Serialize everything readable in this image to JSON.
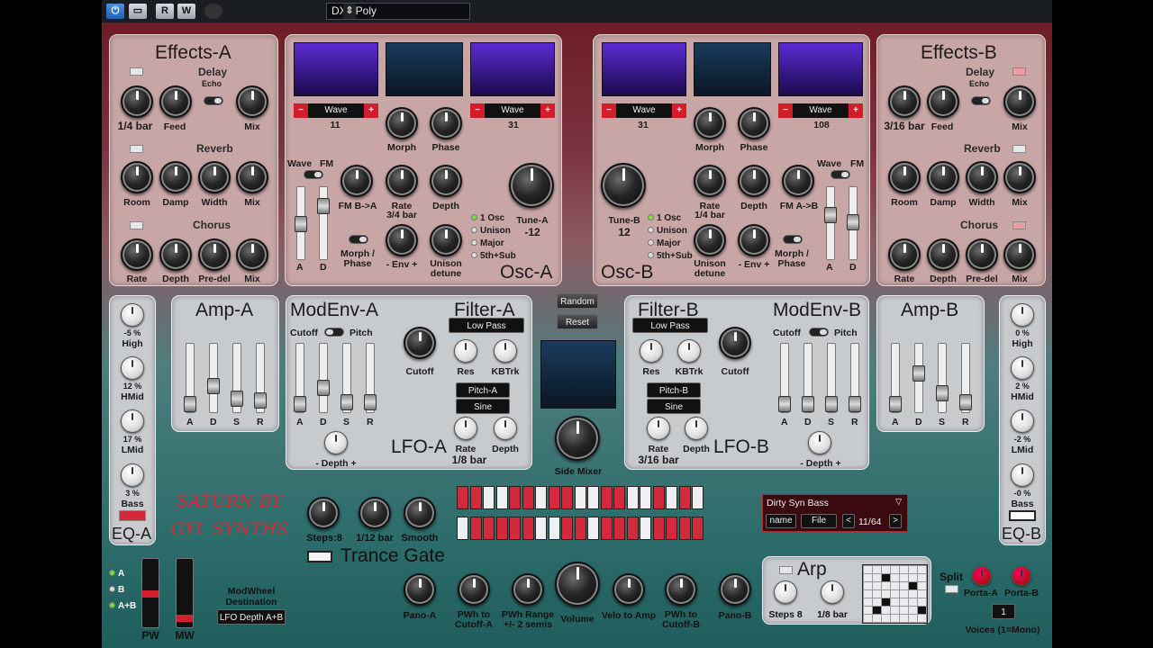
{
  "host": {
    "preset_name": "DX5 Poly",
    "r_label": "R",
    "w_label": "W"
  },
  "fx_a": {
    "title": "Effects-A",
    "delay": "Delay",
    "echo": "Echo",
    "d_knobs": [
      "1/4 bar",
      "Feed",
      "Mix"
    ],
    "reverb": "Reverb",
    "r_knobs": [
      "Room",
      "Damp",
      "Width",
      "Mix"
    ],
    "chorus": "Chorus",
    "c_knobs": [
      "Rate",
      "Depth",
      "Pre-del",
      "Mix"
    ]
  },
  "fx_b": {
    "title": "Effects-B",
    "delay": "Delay",
    "echo": "Echo",
    "d_knobs": [
      "3/16 bar",
      "Feed",
      "Mix"
    ],
    "reverb": "Reverb",
    "r_knobs": [
      "Room",
      "Damp",
      "Width",
      "Mix"
    ],
    "chorus": "Chorus",
    "c_knobs": [
      "Rate",
      "Depth",
      "Pre-del",
      "Mix"
    ]
  },
  "osc_a": {
    "title": "Osc-A",
    "wave": "Wave",
    "w1": "11",
    "w2": "31",
    "morph": "Morph",
    "phase": "Phase",
    "wave_fm_w": "Wave",
    "wave_fm_f": "FM",
    "fm": "FM B->A",
    "rate": "Rate",
    "rate_val": "3/4 bar",
    "depth": "Depth",
    "morph_phase": "Morph / Phase",
    "env": "- Env +",
    "unison": "Unison detune",
    "tune": "Tune-A",
    "tune_val": "-12",
    "modes": [
      "1 Osc",
      "Unison",
      "Major",
      "5th+Sub"
    ],
    "a": "A",
    "d": "D"
  },
  "osc_b": {
    "title": "Osc-B",
    "wave": "Wave",
    "w1": "31",
    "w2": "108",
    "morph": "Morph",
    "phase": "Phase",
    "wave_fm_w": "Wave",
    "wave_fm_f": "FM",
    "fm": "FM A->B",
    "rate": "Rate",
    "rate_val": "1/4 bar",
    "depth": "Depth",
    "morph_phase": "Morph / Phase",
    "env": "- Env +",
    "unison": "Unison detune",
    "tune": "Tune-B",
    "tune_val": "12",
    "modes": [
      "1 Osc",
      "Unison",
      "Major",
      "5th+Sub"
    ],
    "a": "A",
    "d": "D"
  },
  "amp_a": {
    "title": "Amp-A",
    "adsr": [
      "A",
      "D",
      "S",
      "R"
    ]
  },
  "amp_b": {
    "title": "Amp-B",
    "adsr": [
      "A",
      "D",
      "S",
      "R"
    ]
  },
  "modenv_a": {
    "title": "ModEnv-A",
    "cutoff": "Cutoff",
    "pitch": "Pitch",
    "adsr": [
      "A",
      "D",
      "S",
      "R"
    ],
    "depth": "- Depth +"
  },
  "modenv_b": {
    "title": "ModEnv-B",
    "cutoff": "Cutoff",
    "pitch": "Pitch",
    "adsr": [
      "A",
      "D",
      "S",
      "R"
    ],
    "depth": "- Depth +"
  },
  "filter_a": {
    "title": "Filter-A",
    "type": "Low Pass",
    "cutoff": "Cutoff",
    "res": "Res",
    "kbtrk": "KBTrk",
    "lfo_dest": "Pitch-A",
    "lfo_shape": "Sine",
    "lfo_title": "LFO-A",
    "rate": "Rate",
    "depth": "Depth",
    "rate_val": "1/8 bar"
  },
  "filter_b": {
    "title": "Filter-B",
    "type": "Low Pass",
    "cutoff": "Cutoff",
    "res": "Res",
    "kbtrk": "KBTrk",
    "lfo_dest": "Pitch-B",
    "lfo_shape": "Sine",
    "lfo_title": "LFO-B",
    "rate": "Rate",
    "depth": "Depth",
    "rate_val": "3/16 bar"
  },
  "center": {
    "random": "Random",
    "reset": "Reset",
    "side_mixer": "Side Mixer"
  },
  "eq_a": {
    "title": "EQ-A",
    "bands": [
      {
        "val": "-5 %",
        "name": "High"
      },
      {
        "val": "12 %",
        "name": "HMid"
      },
      {
        "val": "17 %",
        "name": "LMid"
      },
      {
        "val": "3 %",
        "name": "Bass"
      }
    ]
  },
  "eq_b": {
    "title": "EQ-B",
    "bands": [
      {
        "val": "0 %",
        "name": "High"
      },
      {
        "val": "2 %",
        "name": "HMid"
      },
      {
        "val": "-2 %",
        "name": "LMid"
      },
      {
        "val": "-0 %",
        "name": "Bass"
      }
    ]
  },
  "brand": {
    "line1": "SATURN BY",
    "line2": "GYL SYNTHS"
  },
  "gate": {
    "steps": "Steps:8",
    "bar": "1/12 bar",
    "smooth": "Smooth",
    "title": "Trance Gate",
    "row1": [
      1,
      1,
      0,
      0,
      1,
      1,
      0,
      1,
      1,
      0,
      0,
      1,
      1,
      0,
      0,
      1,
      0,
      1,
      0
    ],
    "row2": [
      0,
      1,
      1,
      1,
      1,
      1,
      0,
      0,
      1,
      1,
      0,
      1,
      1,
      1,
      0,
      1,
      1,
      1,
      1
    ]
  },
  "bottom": {
    "pano_a": "Pano-A",
    "pwh_cut_a": "PWh to Cutoff-A",
    "pwh_range": "PWh Range +/- 2 semis",
    "volume": "Volume",
    "velo_amp": "Velo to Amp",
    "pwh_cut_b": "PWh to Cutoff-B",
    "pano_b": "Pano-B"
  },
  "modwheel": {
    "a": "A",
    "b": "B",
    "ab": "A+B",
    "dest_title": "ModWheel Destination",
    "dest_value": "LFO Depth A+B",
    "pw": "PW",
    "mw": "MW"
  },
  "preset_box": {
    "name": "Dirty Syn Bass",
    "name_btn": "name",
    "file_btn": "File",
    "count": "11/64",
    "prev": "<",
    "next": ">"
  },
  "arp": {
    "title": "Arp",
    "steps": "Steps 8",
    "bar": "1/8 bar",
    "cells": [
      0,
      0,
      0,
      0,
      0,
      0,
      0,
      0,
      0,
      1,
      0,
      0,
      0,
      0,
      0,
      0,
      0,
      0,
      0,
      1,
      0,
      0,
      0,
      0,
      0,
      0,
      0,
      0,
      0,
      0,
      1,
      0,
      0,
      0,
      0,
      0,
      1,
      0,
      0,
      0,
      0,
      1,
      0,
      0,
      0,
      0,
      0,
      0,
      0
    ]
  },
  "split": {
    "label": "Split",
    "porta_a": "Porta-A",
    "porta_b": "Porta-B",
    "voices": "Voices (1=Mono)",
    "voice_val": "1"
  }
}
